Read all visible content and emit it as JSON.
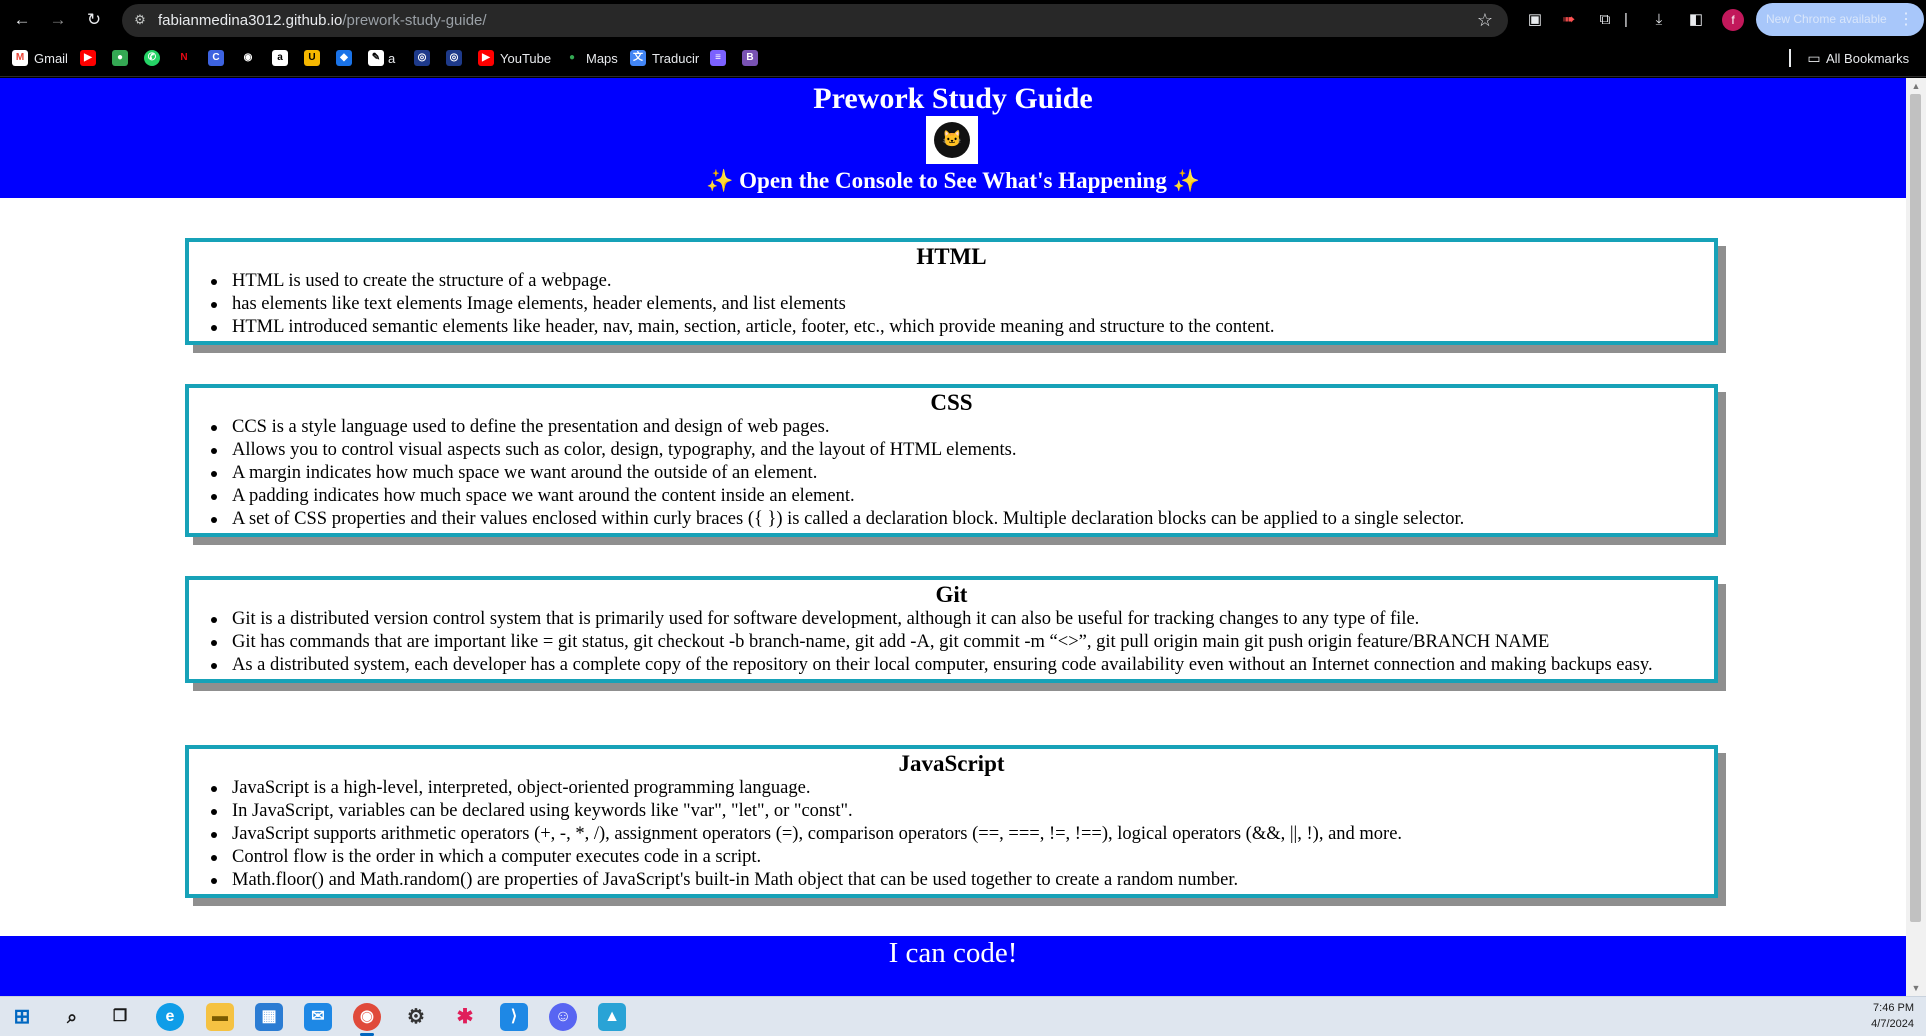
{
  "browser": {
    "url_host": "fabianmedina3012.github.io",
    "url_path": "/prework-study-guide/",
    "update_label": "New Chrome available",
    "profile_initial": "f",
    "bookmarks": [
      {
        "label": "Gmail",
        "icon": "gmail-icon",
        "glyph": "M",
        "color": "#ea4335"
      },
      {
        "label": "",
        "icon": "youtube-icon",
        "glyph": "▶",
        "color": "#ff0000"
      },
      {
        "label": "",
        "icon": "maps-pin-icon",
        "glyph": "●",
        "color": "#34a853"
      },
      {
        "label": "",
        "icon": "whatsapp-icon",
        "glyph": "✆",
        "color": "#25d366"
      },
      {
        "label": "",
        "icon": "netflix-icon",
        "glyph": "N",
        "color": "#e50914"
      },
      {
        "label": "",
        "icon": "canva-icon",
        "glyph": "C",
        "color": "#3d63e0"
      },
      {
        "label": "",
        "icon": "github-icon",
        "glyph": "◉",
        "color": "#333333"
      },
      {
        "label": "",
        "icon": "amazon-icon",
        "glyph": "a",
        "color": "#ffffff"
      },
      {
        "label": "",
        "icon": "bookmark-u-icon",
        "glyph": "U",
        "color": "#f5b700"
      },
      {
        "label": "",
        "icon": "bookmark-blue-icon",
        "glyph": "◆",
        "color": "#1a73e8"
      },
      {
        "label": "a",
        "icon": "bookmark-a-icon",
        "glyph": "✎",
        "color": "#444444"
      },
      {
        "label": "",
        "icon": "bookmark-globe-icon",
        "glyph": "◎",
        "color": "#1e3a8a"
      },
      {
        "label": "",
        "icon": "bookmark-globe2-icon",
        "glyph": "◎",
        "color": "#1e3a8a"
      },
      {
        "label": "YouTube",
        "icon": "youtube-icon",
        "glyph": "▶",
        "color": "#ff0000"
      },
      {
        "label": "Maps",
        "icon": "maps-pin-icon",
        "glyph": "●",
        "color": "#34a853"
      },
      {
        "label": "Traducir",
        "icon": "translate-icon",
        "glyph": "文",
        "color": "#4285f4"
      },
      {
        "label": "",
        "icon": "bookmark-stack-icon",
        "glyph": "≡",
        "color": "#7b61ff"
      },
      {
        "label": "",
        "icon": "bootstrap-icon",
        "glyph": "B",
        "color": "#7952b3"
      }
    ],
    "all_bookmarks_label": "All Bookmarks"
  },
  "page": {
    "title": "Prework Study Guide",
    "subtitle": "Open the Console to See What's Happening",
    "sections": [
      {
        "heading": "HTML",
        "items": [
          "HTML is used to create the structure of a webpage.",
          "has elements like text elements Image elements, header elements, and list elements",
          "HTML introduced semantic elements like header, nav, main, section, article, footer, etc., which provide meaning and structure to the content."
        ]
      },
      {
        "heading": "CSS",
        "items": [
          "CCS is a style language used to define the presentation and design of web pages.",
          "Allows you to control visual aspects such as color, design, typography, and the layout of HTML elements.",
          "A margin indicates how much space we want around the outside of an element.",
          "A padding indicates how much space we want around the content inside an element.",
          "A set of CSS properties and their values enclosed within curly braces ({ }) is called a declaration block. Multiple declaration blocks can be applied to a single selector."
        ]
      },
      {
        "heading": "Git",
        "items": [
          "Git is a distributed version control system that is primarily used for software development, although it can also be useful for tracking changes to any type of file.",
          "Git has commands that are important like = git status, git checkout -b branch-name, git add -A, git commit -m “<>”, git pull origin main git push origin feature/BRANCH NAME",
          "As a distributed system, each developer has a complete copy of the repository on their local computer, ensuring code availability even without an Internet connection and making backups easy."
        ]
      },
      {
        "heading": "JavaScript",
        "items": [
          "JavaScript is a high-level, interpreted, object-oriented programming language.",
          "In JavaScript, variables can be declared using keywords like \"var\", \"let\", or \"const\".",
          "JavaScript supports arithmetic operators (+, -, *, /), assignment operators (=), comparison operators (==, ===, !=, !==), logical operators (&&, ||, !), and more.",
          "Control flow is the order in which a computer executes code in a script.",
          "Math.floor() and Math.random() are properties of JavaScript's built-in Math object that can be used together to create a random number."
        ]
      }
    ],
    "footer": "I can code!"
  },
  "taskbar": {
    "time": "7:46 PM",
    "date": "4/7/2024"
  }
}
